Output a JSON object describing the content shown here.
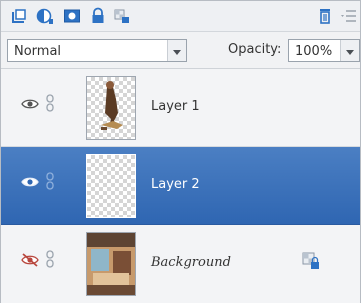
{
  "toolbar": {
    "icons": [
      "new-layer-icon",
      "adjustment-layer-icon",
      "layer-mask-icon",
      "lock-icon",
      "lock-transparency-icon",
      "trash-icon",
      "panel-menu-icon"
    ]
  },
  "blend": {
    "mode": "Normal",
    "opacity_label": "Opacity:",
    "opacity_value": "100%"
  },
  "layers": [
    {
      "name": "Layer 1",
      "visible": true,
      "selected": false
    },
    {
      "name": "Layer 2",
      "visible": true,
      "selected": true
    },
    {
      "name": "Background",
      "visible": false,
      "selected": false,
      "locked": true
    }
  ],
  "colors": {
    "selection": "#3a6fb8",
    "accent_icon": "#2d72c4"
  }
}
